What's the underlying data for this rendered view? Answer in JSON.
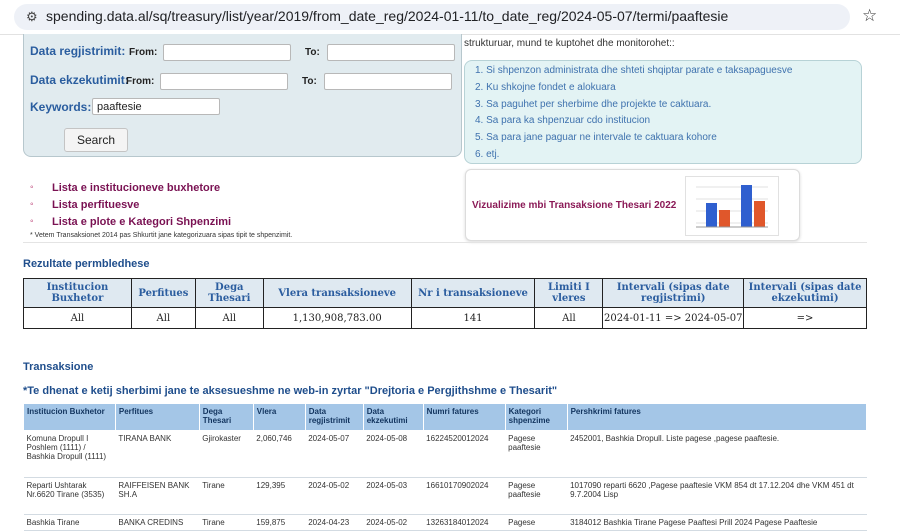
{
  "browser": {
    "url": "spending.data.al/sq/treasury/list/year/2019/from_date_reg/2024-01-11/to_date_reg/2024-05-07/termi/paaftesie",
    "site_info_icon": "tune-icon",
    "bookmark_icon": "star-icon"
  },
  "search": {
    "reg_label": "Data regjistrimit:",
    "exec_label": "Data ekzekutimit:",
    "from_label": "From:",
    "to_label": "To:",
    "keywords_label": "Keywords:",
    "keywords_value": "paaftesie",
    "button": "Search"
  },
  "intro": {
    "text": "strukturuar, mund te kuptohet dhe monitorohet::",
    "items": [
      "1. Si shpenzon administrata dhe shteti shqiptar parate e taksapaguesve",
      "2. Ku shkojne fondet e alokuara",
      "3. Sa paguhet per sherbime dhe projekte te caktuara.",
      "4. Sa para ka shpenzuar cdo institucion",
      "5. Sa para jane paguar ne intervale te caktuara kohore",
      "6. etj."
    ]
  },
  "links": [
    "Lista e institucioneve buxhetore",
    "Lista perfituesve",
    "Lista e plote e Kategori Shpenzimi"
  ],
  "note": "* Vetem Transaksionet 2014 pas Shkurtit jane kategorizuara sipas tipit te shpenzimit.",
  "viz": {
    "title": "Vizualizime mbi Transaksione Thesari 2022",
    "colors": {
      "blue": "#2f5fcf",
      "orange": "#e0572b"
    }
  },
  "summary": {
    "title": "Rezultate permbledhese",
    "headers": [
      "Institucion Buxhetor",
      "Perfitues",
      "Dega Thesari",
      "Vlera transaksioneve",
      "Nr i transaksioneve",
      "Limiti I vleres",
      "Intervali (sipas date regjistrimi)",
      "Intervali (sipas date ekzekutimi)"
    ],
    "row": [
      "All",
      "All",
      "All",
      "1,130,908,783.00",
      "141",
      "All",
      "2024-01-11 => 2024-05-07",
      "=>"
    ]
  },
  "transactions": {
    "title": "Transaksione",
    "notice": "*Te dhenat e ketij sherbimi jane te aksesueshme ne web-in zyrtar \"Drejtoria e Pergjithshme e Thesarit\"",
    "headers": [
      "Institucion Buxhetor",
      "Perfitues",
      "Dega Thesari",
      "Vlera",
      "Data regjistrimit",
      "Data ekzekutimi",
      "Numri fatures",
      "Kategori shpenzime",
      "Pershkrimi fatures"
    ],
    "rows": [
      [
        "Komuna Dropull I Poshlem (1111) / Bashkia Dropull (1111)",
        "TIRANA BANK",
        "Gjirokaster",
        "2,060,746",
        "2024-05-07",
        "2024-05-08",
        "16224520012024",
        "Pagese paaftesie",
        "2452001, Bashkia Dropull. Liste pagese ,pagese paaftesie."
      ],
      [
        "Reparti Ushtarak Nr.6620 Tirane (3535)",
        "RAIFFEISEN BANK SH.A",
        "Tirane",
        "129,395",
        "2024-05-02",
        "2024-05-03",
        "16610170902024",
        "Pagese paaftesie",
        "1017090 reparti 6620 ,Pagese paaftesie VKM 854 dt 17.12.204 dhe VKM 451 dt 9.7.2004 Lisp"
      ],
      [
        "Bashkia Tirane",
        "BANKA CREDINS",
        "Tirane",
        "159,875",
        "2024-04-23",
        "2024-05-02",
        "13263184012024",
        "Pagese",
        "3184012 Bashkia Tirane Pagese Paaftesi Prill 2024 Pagese Paaftesie"
      ]
    ]
  }
}
